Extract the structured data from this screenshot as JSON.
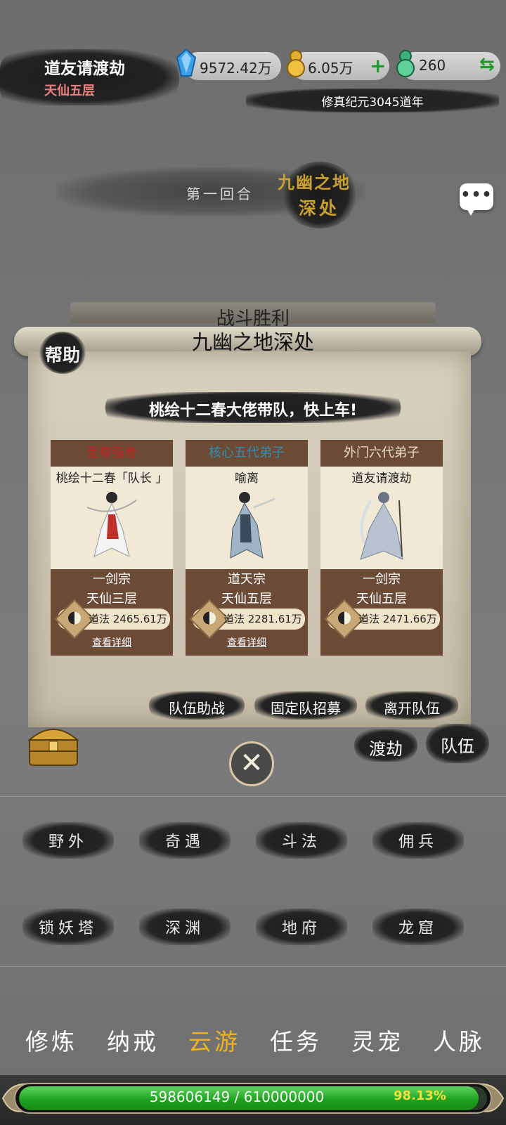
{
  "player": {
    "name": "道友请渡劫",
    "realm": "天仙五层"
  },
  "currencies": [
    {
      "icon": "blue-spirit-stone-icon",
      "value": "9572.42万"
    },
    {
      "icon": "gold-gourd-icon",
      "value": "6.05万",
      "action": "+"
    },
    {
      "icon": "jade-gourd-icon",
      "value": "260",
      "action": "⇆"
    }
  ],
  "era": "修真纪元3045道年",
  "battle": {
    "round": "第一回合",
    "location_line1": "九幽之地",
    "location_line2": "深处"
  },
  "chat_button": "•••",
  "scroll": {
    "result": "战斗胜利",
    "title": "九幽之地深处",
    "help": "帮助",
    "banner": "桃绘十二春大佬带队，快上车!",
    "members": [
      {
        "rank": "至尊强者",
        "rank_color": "#c0201e",
        "name": "桃绘十二春「队长 」",
        "sect": "一剑宗",
        "realm": "天仙三层",
        "power": "道法 2465.61万",
        "detail": "查看详细"
      },
      {
        "rank": "核心五代弟子",
        "rank_color": "#2f8fb0",
        "name": "喻离",
        "sect": "道天宗",
        "realm": "天仙五层",
        "power": "道法 2281.61万",
        "detail": "查看详细"
      },
      {
        "rank": "外门六代弟子",
        "rank_color": "#e8dcc8",
        "name": "道友请渡劫",
        "sect": "一剑宗",
        "realm": "天仙五层",
        "power": "道法 2471.66万",
        "detail": ""
      }
    ],
    "actions": {
      "assist": "队伍助战",
      "recruit": "固定队招募",
      "leave": "离开队伍"
    }
  },
  "side_buttons": {
    "tribulation": "渡劫",
    "team": "队伍"
  },
  "close_icon": "✕",
  "locations": [
    "野外",
    "奇遇",
    "斗法",
    "佣兵",
    "锁妖塔",
    "深渊",
    "地府",
    "龙窟"
  ],
  "tabs": [
    "修炼",
    "纳戒",
    "云游",
    "任务",
    "灵宠",
    "人脉"
  ],
  "active_tab": 2,
  "xp": {
    "text": "598606149 / 610000000",
    "percent_label": "98.13%",
    "fraction": 0.9813
  }
}
